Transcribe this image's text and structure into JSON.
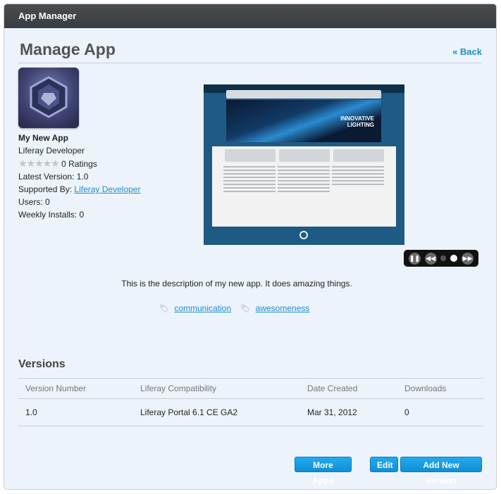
{
  "window": {
    "title": "App Manager"
  },
  "header": {
    "title": "Manage App",
    "back_label": "« Back"
  },
  "app": {
    "name": "My New App",
    "developer": "Liferay Developer",
    "rating": 0,
    "ratings_label": "0 Ratings",
    "latest_version_label": "Latest Version: 1.0",
    "supported_by_prefix": "Supported By:",
    "supported_by_link": "Liferay Developer",
    "users_label": "Users: 0",
    "weekly_installs_label": "Weekly Installs: 0",
    "description": "This is the description of my new app. It does amazing things.",
    "tags": [
      "communication",
      "awesomeness"
    ]
  },
  "screenshot": {
    "banner_text_1": "INNOVATIVE",
    "banner_text_2": "LIGHTING"
  },
  "slideshow": {
    "slide_count": 2,
    "active_slide": 2
  },
  "versions": {
    "title": "Versions",
    "columns": [
      "Version Number",
      "Liferay Compatibility",
      "Date Created",
      "Downloads"
    ],
    "rows": [
      [
        "1.0",
        "Liferay Portal 6.1 CE GA2",
        "Mar 31, 2012",
        "0"
      ]
    ]
  },
  "buttons": {
    "more_apps": "More Apps",
    "edit": "Edit",
    "add_new_version": "Add New Version"
  },
  "colors": {
    "accent": "#1a8fd1",
    "titlebar": "#3f4245",
    "background": "#edf3fb"
  }
}
